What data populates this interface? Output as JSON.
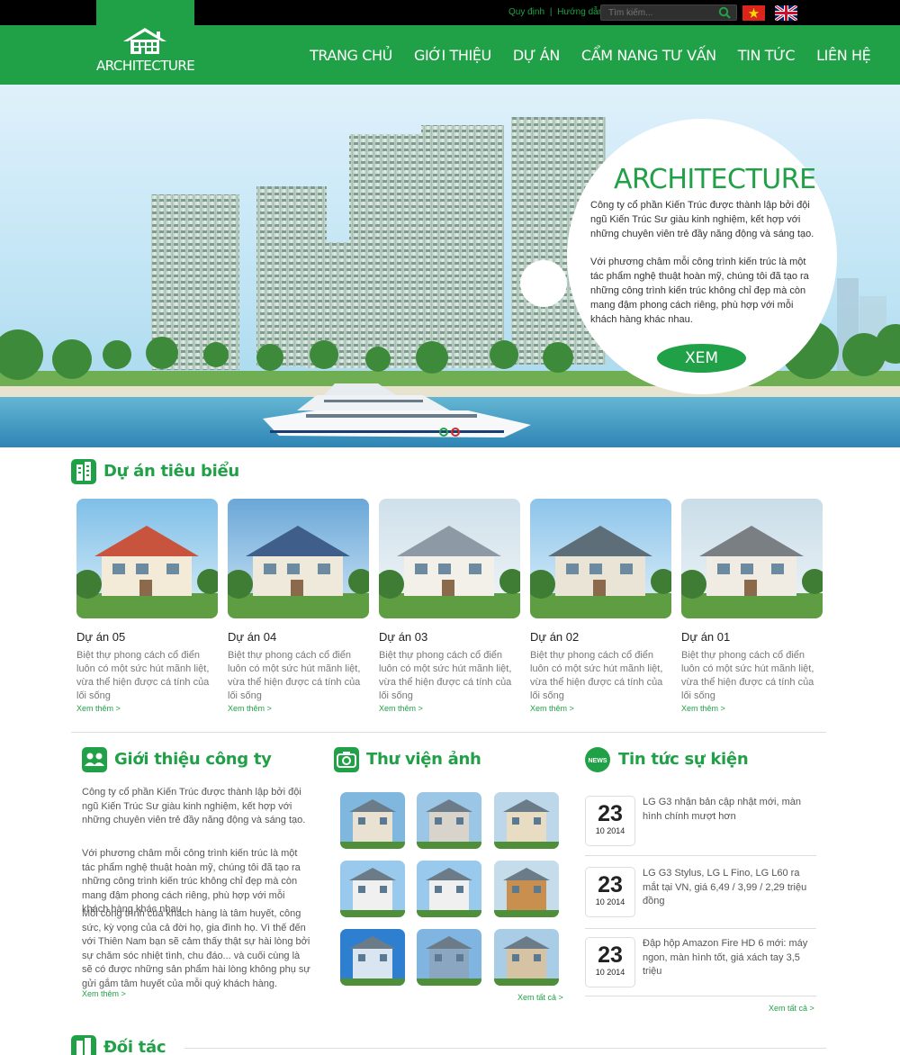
{
  "topbar": {
    "link1": "Quy định",
    "sep": "|",
    "link2": "Hướng dẫn",
    "search_placeholder": "Tìm kiếm..."
  },
  "logo": {
    "text": "ARCHITECTURE"
  },
  "nav": [
    "TRANG CHỦ",
    "GIỚI THIỆU",
    "DỰ ÁN",
    "CẨM NANG TƯ VẤN",
    "TIN TỨC",
    "LIÊN HỆ"
  ],
  "hero": {
    "title": "ARCHITECTURE",
    "p1": "Công ty cổ phần Kiến Trúc được thành lập bởi đội ngũ Kiến Trúc Sư giàu kinh nghiệm, kết hợp với những chuyên viên trẻ đầy năng động và sáng tạo.",
    "p2": "Với phương châm mỗi công trình kiến trúc là một tác phẩm nghệ thuật hoàn mỹ, chúng tôi đã tạo ra những công trình kiến trúc không chỉ đẹp mà còn mang đậm phong cách riêng, phù hợp với mỗi khách hàng khác nhau.",
    "button": "XEM"
  },
  "projects": {
    "title": "Dự án tiêu biểu",
    "items": [
      {
        "name": "Dự án 05",
        "desc": "Biệt thự phong cách cổ điển luôn có một sức hút mãnh liệt, vừa thể hiện được cá tính của lối sống",
        "more": "Xem thêm >"
      },
      {
        "name": "Dự án 04",
        "desc": "Biệt thự phong cách cổ điển luôn có một sức hút mãnh liệt, vừa thể hiện được cá tính của lối sống",
        "more": "Xem thêm >"
      },
      {
        "name": "Dự án 03",
        "desc": "Biệt thự phong cách cổ điển luôn có một sức hút mãnh liệt, vừa thể hiện được cá tính của lối sống",
        "more": "Xem thêm >"
      },
      {
        "name": "Dự án 02",
        "desc": "Biệt thự phong cách cổ điển luôn có một sức hút mãnh liệt, vừa thể hiện được cá tính của lối sống",
        "more": "Xem thêm >"
      },
      {
        "name": "Dự án 01",
        "desc": "Biệt thự phong cách cổ điển luôn có một sức hút mãnh liệt, vừa thể hiện được cá tính của lối sống",
        "more": "Xem thêm >"
      }
    ]
  },
  "intro": {
    "title": "Giới thiệu công ty",
    "p1": "Công ty cổ phần Kiến Trúc được thành lập bởi đội ngũ Kiến Trúc Sư giàu kinh nghiệm, kết hợp với những chuyên viên trẻ đầy năng động và sáng tạo.",
    "p2": "Với phương châm mỗi công trình kiến trúc là một tác phẩm nghệ thuật hoàn mỹ, chúng tôi đã tạo ra những công trình kiến trúc không chỉ đẹp mà còn mang đậm phong cách riêng, phù hợp với mỗi khách hàng khác nhau.",
    "p3": "Mỗi công trình của khách hàng là tâm huyết, công sức, kỳ vọng của cả đời họ, gia đình họ. Vì thế đến với Thiên Nam bạn sẽ cảm thấy thật sự hài lòng bởi sự chăm sóc nhiệt tình, chu đáo... và cuối cùng là sẽ có được những sản phẩm hài lòng không phụ sự gửi gắm tâm huyết của mỗi quý khách hàng.",
    "more": "Xem thêm >"
  },
  "gallery": {
    "title": "Thư viện ảnh",
    "more": "Xem tất cả >"
  },
  "news": {
    "title": "Tin tức sự kiện",
    "items": [
      {
        "day": "23",
        "month": "10 2014",
        "text": "LG G3 nhận bản cập nhật mới, màn hình chính mượt hơn"
      },
      {
        "day": "23",
        "month": "10 2014",
        "text": "LG G3 Stylus, LG L Fino, LG L60 ra mắt tại VN, giá 6,49 / 3,99 / 2,29 triệu đồng"
      },
      {
        "day": "23",
        "month": "10 2014",
        "text": "Đập hộp Amazon Fire HD 6 mới: máy ngon, màn hình tốt, giá xách tay 3,5 triệu"
      }
    ],
    "more": "Xem tất cả >"
  },
  "partners": {
    "title": "Đối tác"
  },
  "colors": {
    "accent": "#21a147",
    "topbar": "#000000"
  }
}
